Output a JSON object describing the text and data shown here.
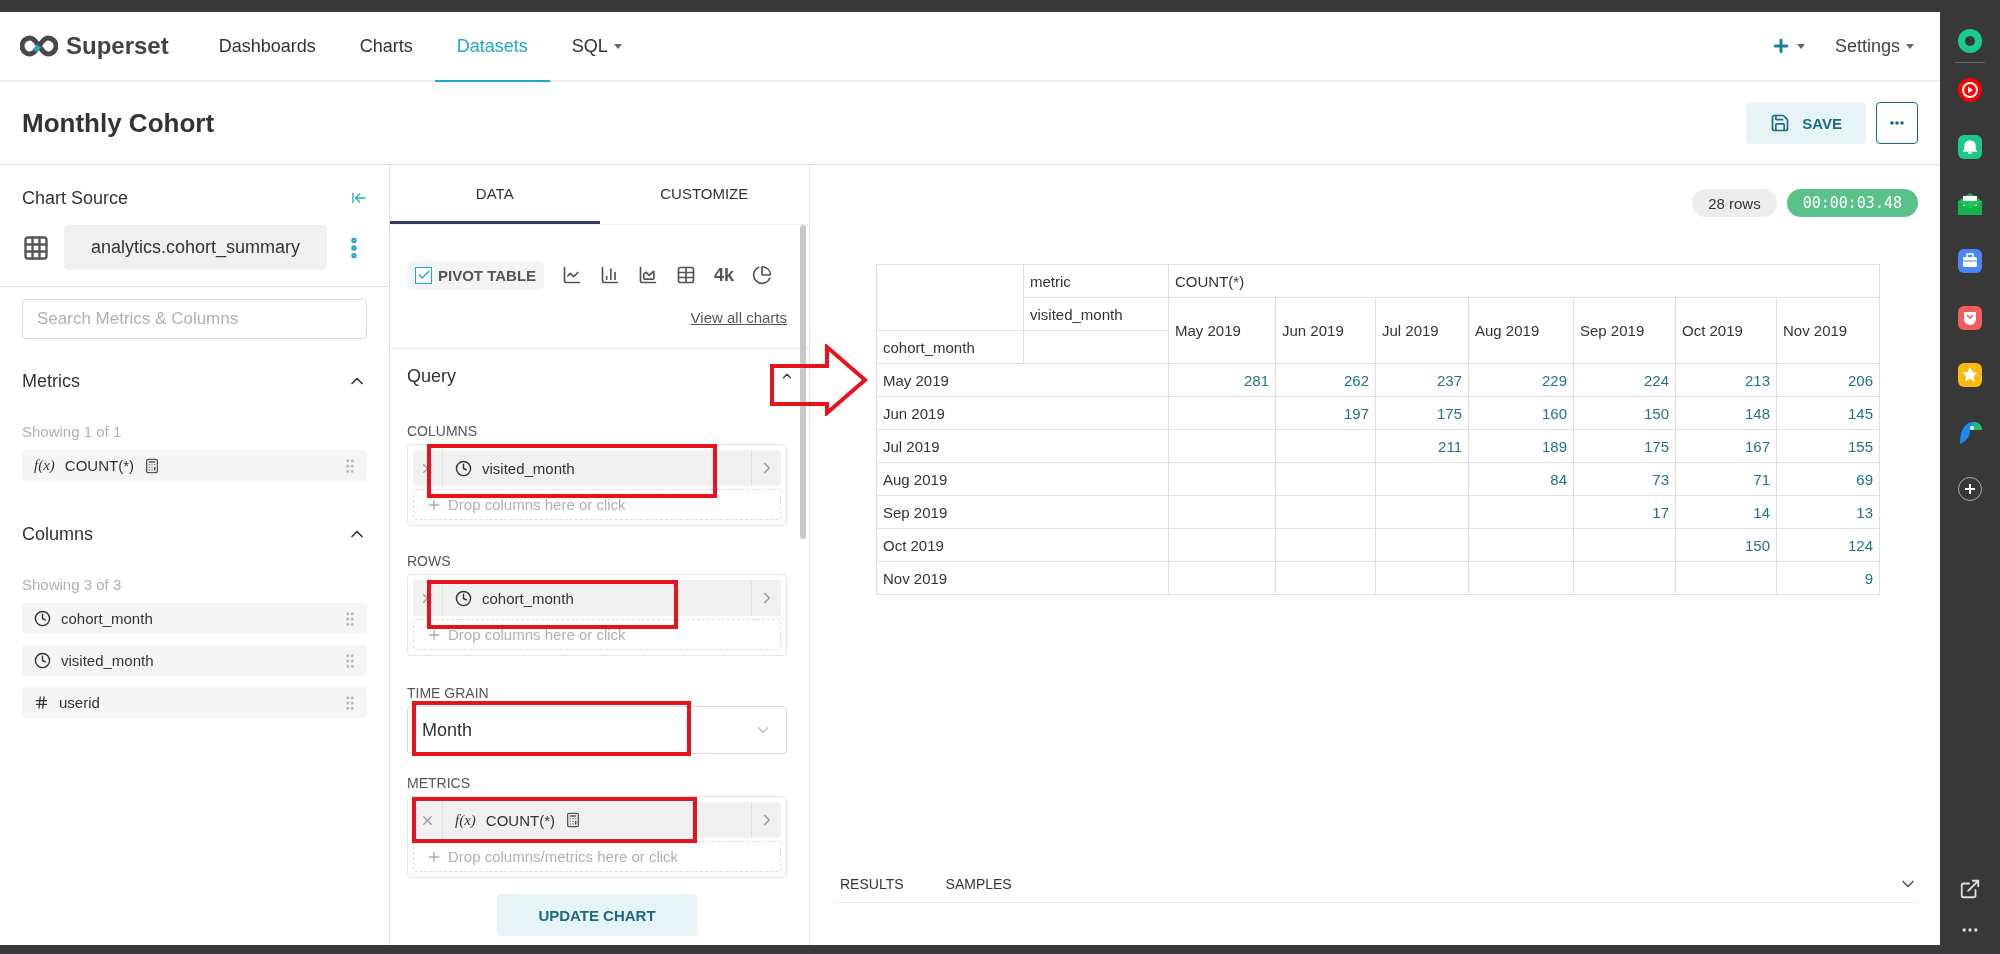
{
  "nav": {
    "brand": "Superset",
    "items": [
      {
        "label": "Dashboards",
        "selected": false,
        "dropdown": false
      },
      {
        "label": "Charts",
        "selected": false,
        "dropdown": false
      },
      {
        "label": "Datasets",
        "selected": true,
        "dropdown": false
      },
      {
        "label": "SQL",
        "selected": false,
        "dropdown": true
      }
    ],
    "settings": "Settings"
  },
  "page_title": "Monthly Cohort",
  "save_button": "SAVE",
  "chart_source": {
    "title": "Chart Source",
    "dataset": "analytics.cohort_summary",
    "search": {
      "placeholder": "Search Metrics & Columns"
    },
    "sections": [
      {
        "title": "Metrics",
        "expanded": true,
        "count": "Showing 1 of 1",
        "items": [
          {
            "kind": "metric",
            "symbol": "f(x)",
            "label": "COUNT(*)"
          }
        ]
      },
      {
        "title": "Columns",
        "expanded": true,
        "count": "Showing 3 of 3",
        "items": [
          {
            "kind": "time",
            "label": "cohort_month"
          },
          {
            "kind": "time",
            "label": "visited_month"
          },
          {
            "kind": "number",
            "label": "userid"
          }
        ]
      }
    ]
  },
  "control_tabs": [
    {
      "label": "DATA",
      "selected": true
    },
    {
      "label": "CUSTOMIZE",
      "selected": false
    }
  ],
  "chart_type": {
    "label": "PIVOT TABLE",
    "checked": true,
    "big_number": "4k",
    "view_all": "View all charts"
  },
  "query": {
    "title": "Query",
    "expanded": true,
    "controls": [
      {
        "kind": "pills",
        "label": "COLUMNS",
        "pills": [
          {
            "kind": "time",
            "label": "visited_month"
          }
        ],
        "drop_hint": "Drop columns here or click"
      },
      {
        "kind": "pills",
        "label": "ROWS",
        "pills": [
          {
            "kind": "time",
            "label": "cohort_month"
          }
        ],
        "drop_hint": "Drop columns here or click"
      },
      {
        "kind": "select",
        "label": "TIME GRAIN",
        "value": "Month"
      },
      {
        "kind": "pills",
        "label": "METRICS",
        "pills": [
          {
            "kind": "metric",
            "symbol": "f(x)",
            "label": "COUNT(*)"
          }
        ],
        "drop_hint": "Drop columns/metrics here or click"
      }
    ]
  },
  "update_button": "UPDATE CHART",
  "badges": {
    "rows": "28 rows",
    "timer": "00:00:03.48"
  },
  "pivot": {
    "col_dims": [
      "metric",
      "visited_month"
    ],
    "row_dim": "cohort_month",
    "metric": "COUNT(*)",
    "columns": [
      "May 2019",
      "Jun 2019",
      "Jul 2019",
      "Aug 2019",
      "Sep 2019",
      "Oct 2019",
      "Nov 2019"
    ],
    "rows": [
      {
        "label": "May 2019",
        "cells": [
          "281",
          "262",
          "237",
          "229",
          "224",
          "213",
          "206"
        ]
      },
      {
        "label": "Jun 2019",
        "cells": [
          null,
          "197",
          "175",
          "160",
          "150",
          "148",
          "145"
        ]
      },
      {
        "label": "Jul 2019",
        "cells": [
          null,
          null,
          "211",
          "189",
          "175",
          "167",
          "155"
        ]
      },
      {
        "label": "Aug 2019",
        "cells": [
          null,
          null,
          null,
          "84",
          "73",
          "71",
          "69"
        ]
      },
      {
        "label": "Sep 2019",
        "cells": [
          null,
          null,
          null,
          null,
          "17",
          "14",
          "13"
        ]
      },
      {
        "label": "Oct 2019",
        "cells": [
          null,
          null,
          null,
          null,
          null,
          "150",
          "124"
        ]
      },
      {
        "label": "Nov 2019",
        "cells": [
          null,
          null,
          null,
          null,
          null,
          null,
          "9"
        ]
      }
    ]
  },
  "bottom_tabs": [
    {
      "label": "RESULTS"
    },
    {
      "label": "SAMPLES"
    }
  ]
}
